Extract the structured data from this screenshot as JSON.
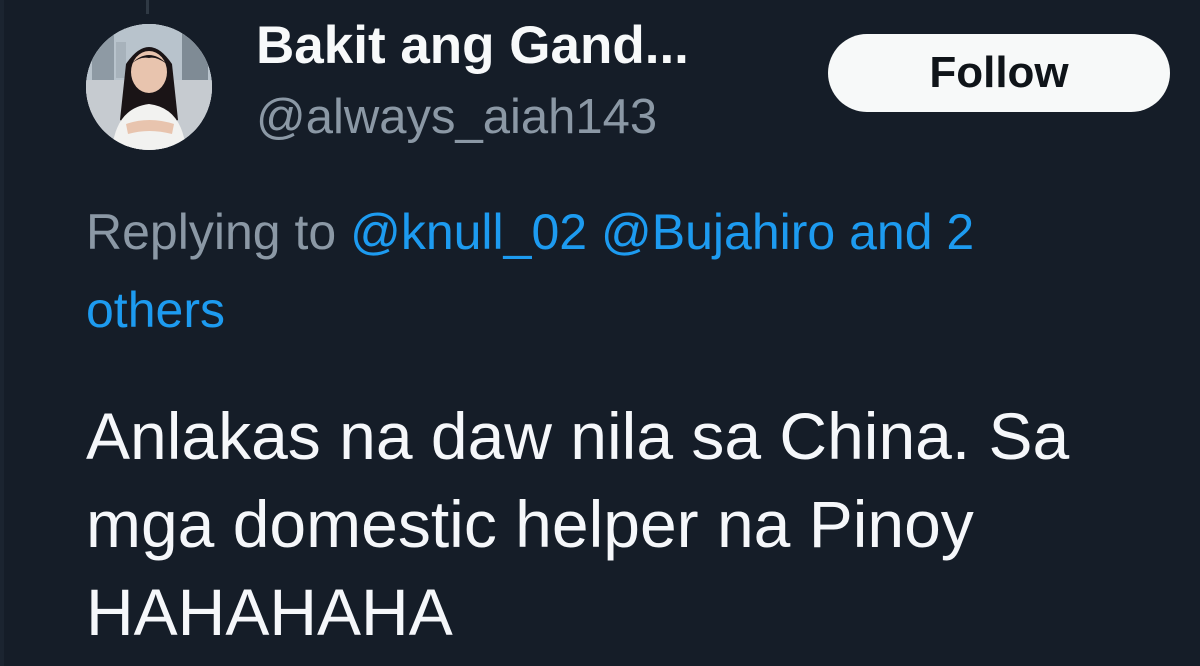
{
  "author": {
    "display_name": "Bakit ang Gand...",
    "handle": "@always_aiah143"
  },
  "follow_label": "Follow",
  "reply": {
    "prefix": "Replying to",
    "mentions": [
      "@knull_02",
      "@Bujahiro"
    ],
    "and_text": "and 2",
    "others_text": "others"
  },
  "tweet": {
    "lines": [
      "Anlakas na daw nila sa China. Sa",
      "mga domestic helper na Pinoy",
      "HAHAHAHA"
    ]
  },
  "colors": {
    "background": "#151d28",
    "link": "#1d9bf0",
    "secondary": "#8b98a5",
    "primary_text": "#f5f7fa",
    "follow_button_bg": "#f7f9f9"
  },
  "icons": {
    "avatar": "profile-photo"
  }
}
